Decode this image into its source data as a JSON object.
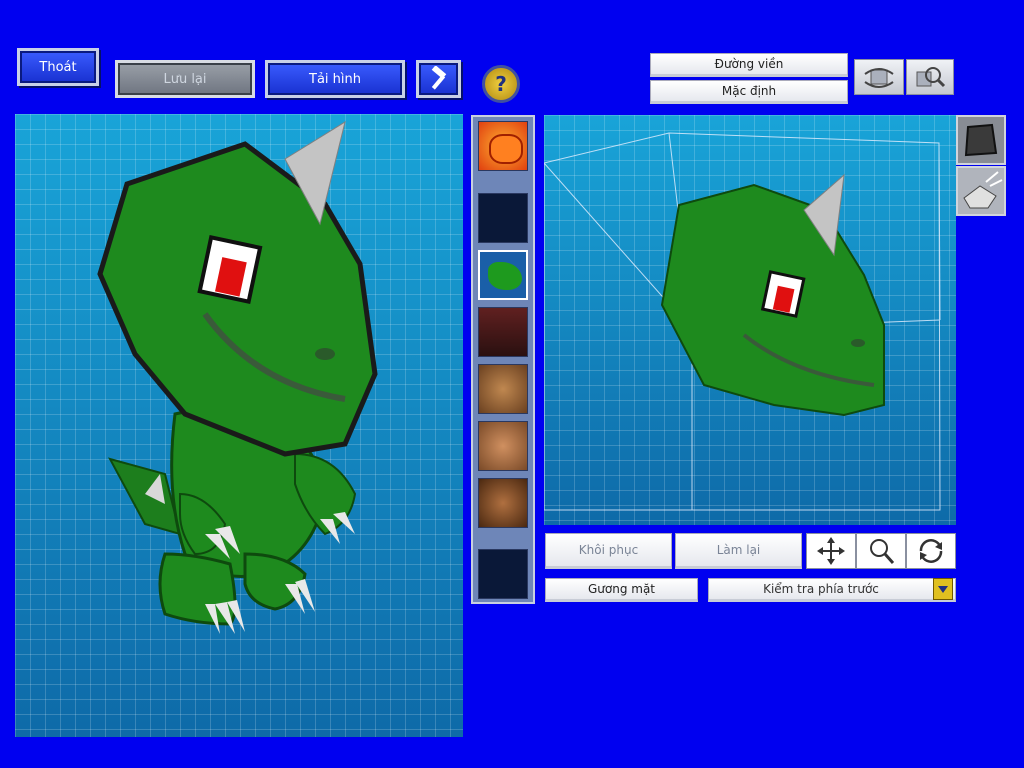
{
  "toolbar": {
    "exit_label": "Thoát",
    "save_label": "Lưu lại",
    "remodel_label": "Tải hình",
    "hammer_icon": "hammer-icon",
    "help_icon": "question-icon"
  },
  "preview_options": {
    "outline_label": "Đường viền",
    "default_label": "Mặc định"
  },
  "view_controls": {
    "restore_label": "Khôi phục",
    "redo_label": "Làm lại",
    "face_label": "Gương mặt",
    "view_select_value": "Kiểm tra phía trước"
  },
  "colors": {
    "background": "#0000f0",
    "grid": "#1a8ec8",
    "creature_green": "#1e8a1e"
  }
}
